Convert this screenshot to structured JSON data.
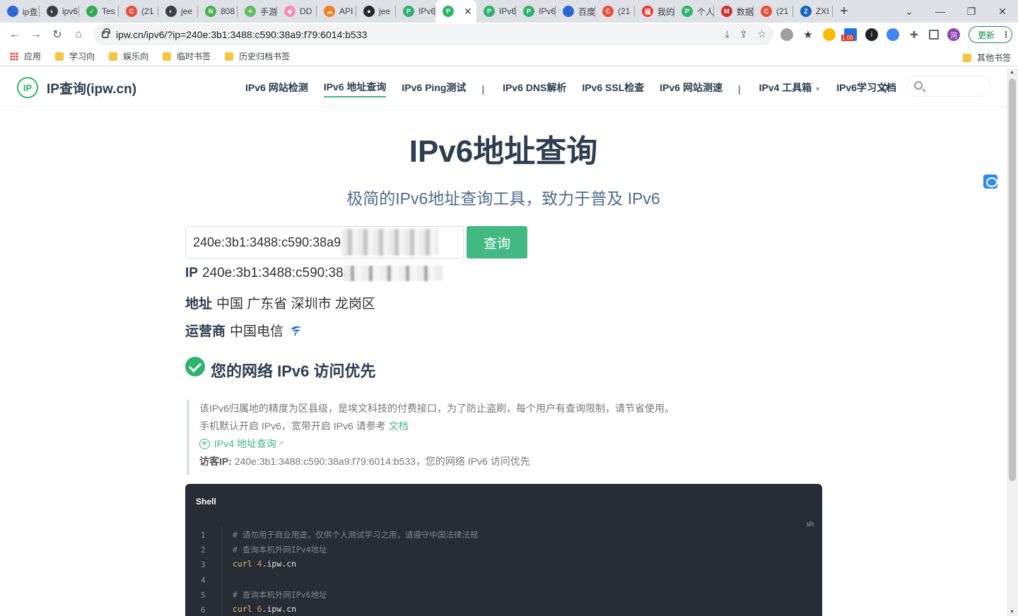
{
  "browser": {
    "tabs": [
      {
        "label": "ip查",
        "color": "#3367d6",
        "glyph": "🐾"
      },
      {
        "label": "ipv6",
        "color": "#3c4043",
        "glyph": "◐"
      },
      {
        "label": "Tes",
        "color": "#34a853",
        "glyph": "✓"
      },
      {
        "label": "(21",
        "color": "#e94e3c",
        "glyph": "C"
      },
      {
        "label": "jee",
        "color": "#3c4043",
        "glyph": "◐"
      },
      {
        "label": "808",
        "color": "#4caf50",
        "glyph": "N"
      },
      {
        "label": "手游",
        "color": "#66bb6a",
        "glyph": "✶"
      },
      {
        "label": "DD",
        "color": "#f48fb1",
        "glyph": "◆"
      },
      {
        "label": "API",
        "color": "#f38020",
        "glyph": "☁"
      },
      {
        "label": "jee",
        "color": "#24292e",
        "glyph": "●"
      },
      {
        "label": "IPv6",
        "color": "#2fb36c",
        "glyph": "P"
      },
      {
        "label": "",
        "color": "#2fb36c",
        "glyph": "P",
        "active": true
      },
      {
        "label": "IPv6",
        "color": "#2fb36c",
        "glyph": "P"
      },
      {
        "label": "IPv6",
        "color": "#2fb36c",
        "glyph": "P"
      },
      {
        "label": "百度",
        "color": "#3367d6",
        "glyph": "🐾"
      },
      {
        "label": "(21",
        "color": "#e94e3c",
        "glyph": "C"
      },
      {
        "label": "我的",
        "color": "#e53935",
        "glyph": "福"
      },
      {
        "label": "个人",
        "color": "#2fb36c",
        "glyph": "P"
      },
      {
        "label": "数据",
        "color": "#d32f2f",
        "glyph": "M"
      },
      {
        "label": "(21",
        "color": "#e94e3c",
        "glyph": "C"
      },
      {
        "label": "ZXI",
        "color": "#1565c0",
        "glyph": "Z"
      }
    ],
    "active_close": "✕",
    "new_tab": "+",
    "window_controls": {
      "dropdown": "⌄",
      "minimize": "—",
      "restore": "❐",
      "close": "✕"
    },
    "nav": {
      "back": "←",
      "forward": "→",
      "reload": "↻",
      "home": "⌂"
    },
    "url": "ipw.cn/ipv6/?ip=240e:3b1:3488:c590:38a9:f79:6014:b533",
    "extensions_badge": "1.00",
    "update_label": "更新",
    "bookmarks": [
      {
        "label": "应用",
        "type": "apps"
      },
      {
        "label": "学习向",
        "type": "folder"
      },
      {
        "label": "娱乐向",
        "type": "folder"
      },
      {
        "label": "临时书签",
        "type": "folder"
      },
      {
        "label": "历史归档书签",
        "type": "folder"
      }
    ],
    "other_bookmarks": "其他书签"
  },
  "site": {
    "logo_mark": "IP",
    "logo_text": "IP查询(ipw.cn)",
    "nav": [
      {
        "label": "IPv6 网站检测"
      },
      {
        "label": "IPv6 地址查询",
        "active": true
      },
      {
        "label": "IPv6 Ping测试"
      },
      {
        "label": "|",
        "sep": true
      },
      {
        "label": "IPv6 DNS解析"
      },
      {
        "label": "IPv6 SSL检查"
      },
      {
        "label": "IPv6 网站测速"
      },
      {
        "label": "|",
        "sep": true
      },
      {
        "label": "IPv4 工具箱",
        "dropdown": true
      },
      {
        "label": "IPv6学习文档"
      }
    ]
  },
  "main": {
    "title": "IPv6地址查询",
    "subtitle": "极简的IPv6地址查询工具，致力于普及 IPv6",
    "input_value": "240e:3b1:3488:c590:38a9",
    "query_button": "查询",
    "ip_label": "IP",
    "ip_value": "240e:3b1:3488:c590:38a",
    "addr_label": "地址",
    "addr_value": "中国 广东省 深圳市 龙岗区",
    "isp_label": "运营商",
    "isp_value": "中国电信",
    "status_text": "您的网络 IPv6 访问优先",
    "tip": {
      "line1": "该IPv6归属地的精度为区县级，是埃文科技的付费接口，为了防止盗刷，每个用户有查询限制，请节省使用。",
      "line2_prefix": "手机默认开启 IPv6，宽带开启 IPv6 请参考",
      "line2_link": "文档",
      "ipv4_link": "IPv4 地址查询",
      "visitor_label": "访客IP:",
      "visitor_value": "240e:3b1:3488:c590:38a9:f79:6014:b533，您的网络 IPv6 访问优先"
    },
    "code": {
      "tab": "Shell",
      "lang": "sh",
      "lines": [
        {
          "n": "1",
          "comment": "# 请勿用于商业用途，仅供个人测试学习之用，请遵守中国法律法规"
        },
        {
          "n": "2",
          "comment": "# 查询本机外网IPv4地址"
        },
        {
          "n": "3",
          "cmd": "curl",
          "num": "4",
          "rest": ".ipw.cn"
        },
        {
          "n": "4"
        },
        {
          "n": "5",
          "comment": "# 查询本机外网IPv6地址"
        },
        {
          "n": "6",
          "cmd": "curl",
          "num": "6",
          "rest": ".ipw.cn"
        }
      ]
    }
  }
}
